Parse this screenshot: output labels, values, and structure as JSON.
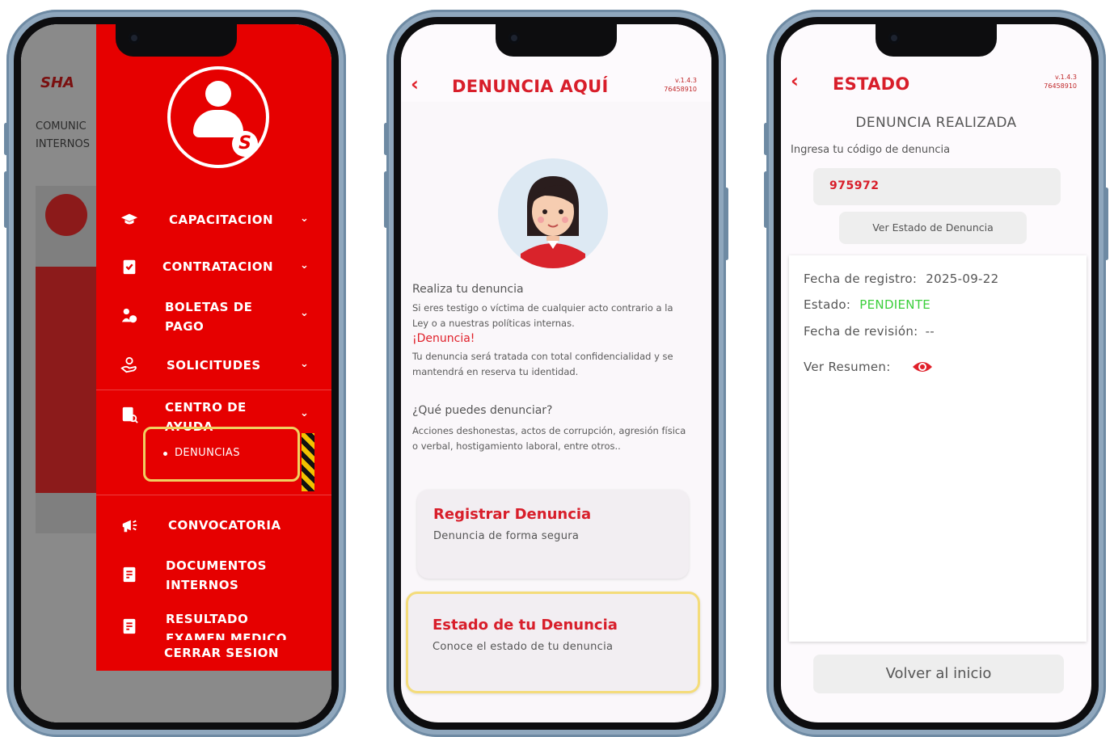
{
  "phone1": {
    "background": {
      "logo": "SHA",
      "text_lines": [
        "COMUNIC",
        "INTERNOS"
      ]
    },
    "drawer": {
      "menu": [
        {
          "label_lines": [
            "CAPACITACION"
          ],
          "icon": "graduation-cap-icon"
        },
        {
          "label_lines": [
            "CONTRATACION"
          ],
          "icon": "clipboard-check-icon"
        },
        {
          "label_lines": [
            "BOLETAS DE",
            "PAGO"
          ],
          "icon": "payment-icon"
        },
        {
          "label_lines": [
            "SOLICITUDES"
          ],
          "icon": "hand-request-icon"
        },
        {
          "label_lines": [
            "CENTRO DE",
            "AYUDA"
          ],
          "icon": "help-document-icon"
        }
      ],
      "submenu_item": "DENUNCIAS",
      "menu2": [
        {
          "label_lines": [
            "CONVOCATORIA"
          ],
          "icon": "megaphone-icon"
        },
        {
          "label_lines": [
            "DOCUMENTOS",
            "INTERNOS"
          ],
          "icon": "document-icon"
        },
        {
          "label_lines": [
            "RESULTADO",
            "EXAMEN MEDICO"
          ],
          "icon": "medical-document-icon"
        }
      ],
      "logout": "CERRAR SESION",
      "badge_letter": "S",
      "accent": "#e60000"
    }
  },
  "phone2": {
    "title": "DENUNCIA AQUÍ",
    "version": [
      "v.1.4.3",
      "76458910"
    ],
    "intro_heading": "Realiza tu denuncia",
    "intro_text": "Si eres testigo o víctima de cualquier acto contrario a la Ley o a nuestras políticas internas.",
    "cta": "¡Denuncia!",
    "confidential_text": "Tu denuncia será tratada con total confidencialidad y se mantendrá en reserva tu identidad.",
    "question": "¿Qué puedes denunciar?",
    "examples": "Acciones deshonestas, actos de corrupción, agresión física o verbal, hostigamiento laboral, entre otros..",
    "cards": [
      {
        "title": "Registrar Denuncia",
        "subtitle": "Denuncia de forma segura"
      },
      {
        "title": "Estado de tu Denuncia",
        "subtitle": "Conoce el estado de tu denuncia"
      }
    ]
  },
  "phone3": {
    "title": "ESTADO",
    "version": [
      "v.1.4.3",
      "76458910"
    ],
    "heading": "DENUNCIA REALIZADA",
    "code_label": "Ingresa tu código de denuncia",
    "code_value": "975972",
    "check_button": "Ver Estado de Denuncia",
    "fields": {
      "registro_label": "Fecha de registro:",
      "registro_value": "2025-09-22",
      "estado_label": "Estado:",
      "estado_value": "PENDIENTE",
      "revision_label": "Fecha de revisión:",
      "revision_value": "--",
      "resumen_label": "Ver Resumen:"
    },
    "status_color": "#3ccf3c",
    "home_button": "Volver al inicio"
  }
}
